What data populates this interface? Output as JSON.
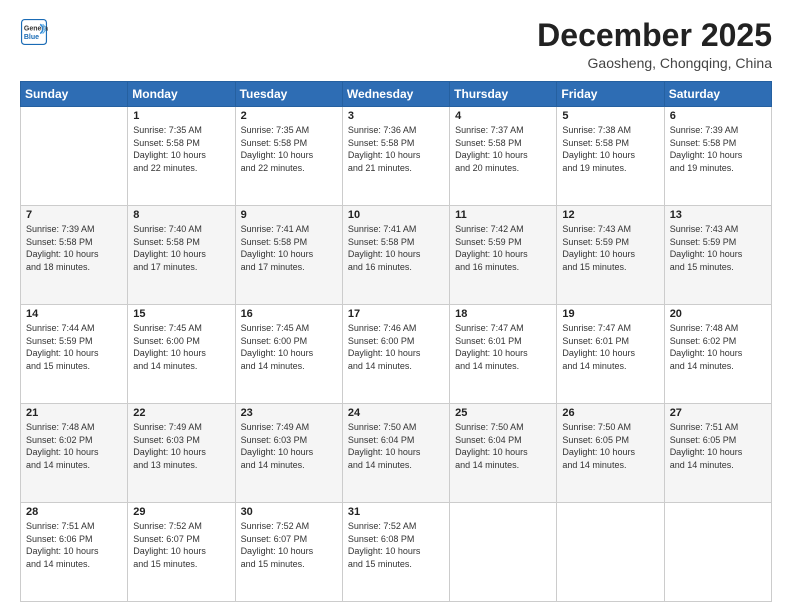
{
  "header": {
    "logo_line1": "General",
    "logo_line2": "Blue",
    "month": "December 2025",
    "location": "Gaosheng, Chongqing, China"
  },
  "weekdays": [
    "Sunday",
    "Monday",
    "Tuesday",
    "Wednesday",
    "Thursday",
    "Friday",
    "Saturday"
  ],
  "weeks": [
    [
      {
        "day": "",
        "info": ""
      },
      {
        "day": "1",
        "info": "Sunrise: 7:35 AM\nSunset: 5:58 PM\nDaylight: 10 hours\nand 22 minutes."
      },
      {
        "day": "2",
        "info": "Sunrise: 7:35 AM\nSunset: 5:58 PM\nDaylight: 10 hours\nand 22 minutes."
      },
      {
        "day": "3",
        "info": "Sunrise: 7:36 AM\nSunset: 5:58 PM\nDaylight: 10 hours\nand 21 minutes."
      },
      {
        "day": "4",
        "info": "Sunrise: 7:37 AM\nSunset: 5:58 PM\nDaylight: 10 hours\nand 20 minutes."
      },
      {
        "day": "5",
        "info": "Sunrise: 7:38 AM\nSunset: 5:58 PM\nDaylight: 10 hours\nand 19 minutes."
      },
      {
        "day": "6",
        "info": "Sunrise: 7:39 AM\nSunset: 5:58 PM\nDaylight: 10 hours\nand 19 minutes."
      }
    ],
    [
      {
        "day": "7",
        "info": "Sunrise: 7:39 AM\nSunset: 5:58 PM\nDaylight: 10 hours\nand 18 minutes."
      },
      {
        "day": "8",
        "info": "Sunrise: 7:40 AM\nSunset: 5:58 PM\nDaylight: 10 hours\nand 17 minutes."
      },
      {
        "day": "9",
        "info": "Sunrise: 7:41 AM\nSunset: 5:58 PM\nDaylight: 10 hours\nand 17 minutes."
      },
      {
        "day": "10",
        "info": "Sunrise: 7:41 AM\nSunset: 5:58 PM\nDaylight: 10 hours\nand 16 minutes."
      },
      {
        "day": "11",
        "info": "Sunrise: 7:42 AM\nSunset: 5:59 PM\nDaylight: 10 hours\nand 16 minutes."
      },
      {
        "day": "12",
        "info": "Sunrise: 7:43 AM\nSunset: 5:59 PM\nDaylight: 10 hours\nand 15 minutes."
      },
      {
        "day": "13",
        "info": "Sunrise: 7:43 AM\nSunset: 5:59 PM\nDaylight: 10 hours\nand 15 minutes."
      }
    ],
    [
      {
        "day": "14",
        "info": "Sunrise: 7:44 AM\nSunset: 5:59 PM\nDaylight: 10 hours\nand 15 minutes."
      },
      {
        "day": "15",
        "info": "Sunrise: 7:45 AM\nSunset: 6:00 PM\nDaylight: 10 hours\nand 14 minutes."
      },
      {
        "day": "16",
        "info": "Sunrise: 7:45 AM\nSunset: 6:00 PM\nDaylight: 10 hours\nand 14 minutes."
      },
      {
        "day": "17",
        "info": "Sunrise: 7:46 AM\nSunset: 6:00 PM\nDaylight: 10 hours\nand 14 minutes."
      },
      {
        "day": "18",
        "info": "Sunrise: 7:47 AM\nSunset: 6:01 PM\nDaylight: 10 hours\nand 14 minutes."
      },
      {
        "day": "19",
        "info": "Sunrise: 7:47 AM\nSunset: 6:01 PM\nDaylight: 10 hours\nand 14 minutes."
      },
      {
        "day": "20",
        "info": "Sunrise: 7:48 AM\nSunset: 6:02 PM\nDaylight: 10 hours\nand 14 minutes."
      }
    ],
    [
      {
        "day": "21",
        "info": "Sunrise: 7:48 AM\nSunset: 6:02 PM\nDaylight: 10 hours\nand 14 minutes."
      },
      {
        "day": "22",
        "info": "Sunrise: 7:49 AM\nSunset: 6:03 PM\nDaylight: 10 hours\nand 13 minutes."
      },
      {
        "day": "23",
        "info": "Sunrise: 7:49 AM\nSunset: 6:03 PM\nDaylight: 10 hours\nand 14 minutes."
      },
      {
        "day": "24",
        "info": "Sunrise: 7:50 AM\nSunset: 6:04 PM\nDaylight: 10 hours\nand 14 minutes."
      },
      {
        "day": "25",
        "info": "Sunrise: 7:50 AM\nSunset: 6:04 PM\nDaylight: 10 hours\nand 14 minutes."
      },
      {
        "day": "26",
        "info": "Sunrise: 7:50 AM\nSunset: 6:05 PM\nDaylight: 10 hours\nand 14 minutes."
      },
      {
        "day": "27",
        "info": "Sunrise: 7:51 AM\nSunset: 6:05 PM\nDaylight: 10 hours\nand 14 minutes."
      }
    ],
    [
      {
        "day": "28",
        "info": "Sunrise: 7:51 AM\nSunset: 6:06 PM\nDaylight: 10 hours\nand 14 minutes."
      },
      {
        "day": "29",
        "info": "Sunrise: 7:52 AM\nSunset: 6:07 PM\nDaylight: 10 hours\nand 15 minutes."
      },
      {
        "day": "30",
        "info": "Sunrise: 7:52 AM\nSunset: 6:07 PM\nDaylight: 10 hours\nand 15 minutes."
      },
      {
        "day": "31",
        "info": "Sunrise: 7:52 AM\nSunset: 6:08 PM\nDaylight: 10 hours\nand 15 minutes."
      },
      {
        "day": "",
        "info": ""
      },
      {
        "day": "",
        "info": ""
      },
      {
        "day": "",
        "info": ""
      }
    ]
  ]
}
